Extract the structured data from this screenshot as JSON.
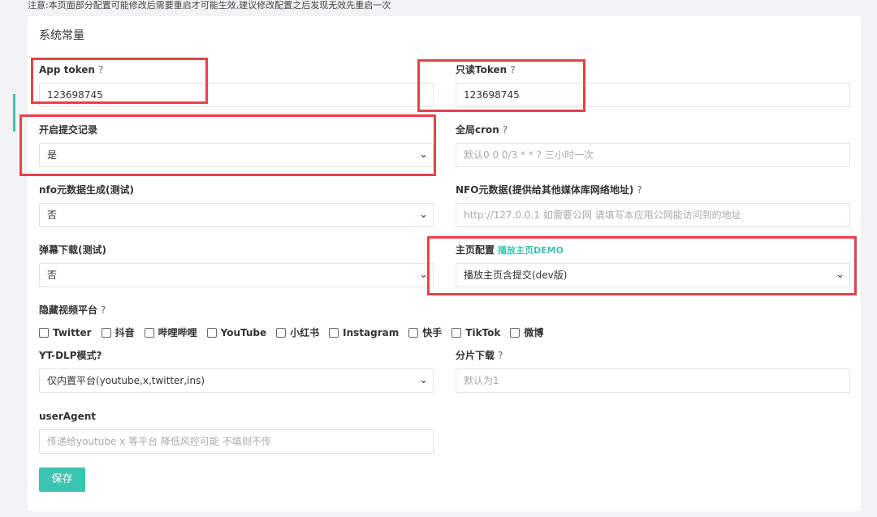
{
  "notice": "注意:本页面部分配置可能修改后需要重启才可能生效,建议修改配置之后发现无效先重启一次",
  "section_title": "系统常量",
  "fields": {
    "app_token": {
      "label": "App token",
      "q": "?",
      "value": "123698745"
    },
    "readonly_token": {
      "label": "只读Token",
      "q": "?",
      "value": "123698745"
    },
    "submit_log": {
      "label": "开启提交记录",
      "value": "是"
    },
    "global_cron": {
      "label": "全局cron",
      "q": "?",
      "placeholder": "默认0 0 0/3 * * ?  三小时一次"
    },
    "nfo_gen": {
      "label": "nfo元数据生成(测试)",
      "value": "否"
    },
    "nfo_url": {
      "label": "NFO元数据(提供给其他媒体库网络地址)",
      "q": "?",
      "placeholder": "http://127.0.0.1 如需要公网 请填写本应用公网能访问到的地址"
    },
    "danmaku": {
      "label": "弹幕下载(测试)",
      "value": "否"
    },
    "home_config": {
      "label": "主页配置",
      "link": "播放主页DEMO",
      "value": "播放主页含提交(dev版)"
    },
    "hidden_platforms": {
      "label": "隐藏视频平台",
      "q": "?"
    },
    "ytdlp_mode": {
      "label": "YT-DLP模式?",
      "value": "仅内置平台(youtube,x,twitter,ins)"
    },
    "chunk_download": {
      "label": "分片下载",
      "q": "?",
      "placeholder": "默认为1"
    },
    "user_agent": {
      "label": "userAgent",
      "placeholder": "传递给youtube  x 等平台 降低风控可能 不填则不传"
    }
  },
  "platforms": [
    "Twitter",
    "抖音",
    "哔哩哔哩",
    "YouTube",
    "小红书",
    "Instagram",
    "快手",
    "TikTok",
    "微博"
  ],
  "save_label": "保存",
  "colors": {
    "accent": "#3cc4b2",
    "highlight": "#e8414a",
    "card": "#ffffff",
    "bg": "#f2f3f5"
  }
}
